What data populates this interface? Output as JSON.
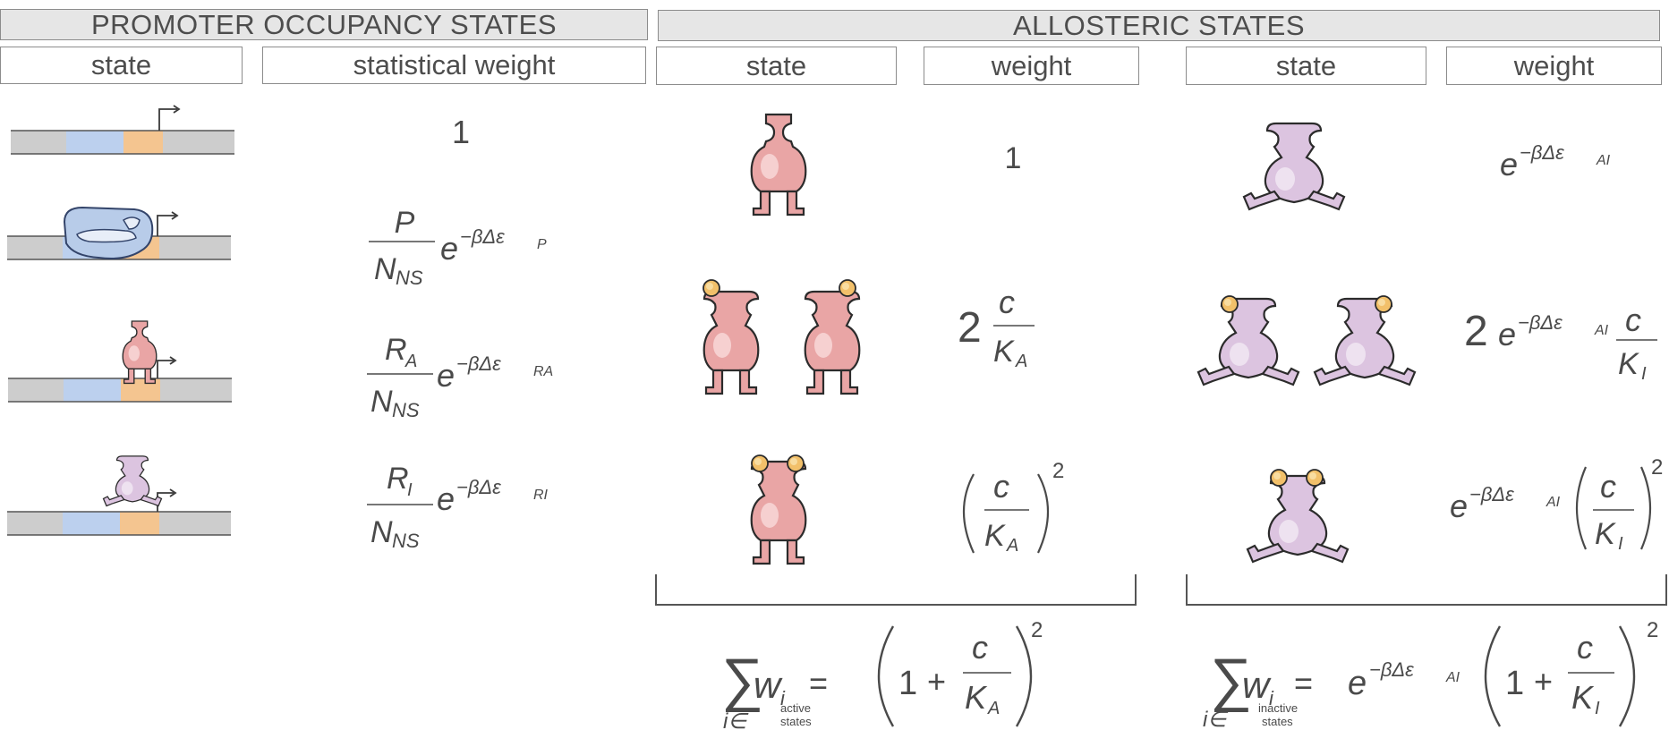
{
  "promoter": {
    "title": "PROMOTER OCCUPANCY STATES",
    "col_state": "state",
    "col_weight": "statistical weight",
    "rows": [
      {
        "state": "empty promoter",
        "weight": "1"
      },
      {
        "state": "RNAP bound",
        "weight": "P / N_NS · e^(−βΔε_P)"
      },
      {
        "state": "active repressor bound",
        "weight": "R_A / N_NS · e^(−βΔε_RA)"
      },
      {
        "state": "inactive repressor bound",
        "weight": "R_I / N_NS · e^(−βΔε_RI)"
      }
    ]
  },
  "allosteric": {
    "title": "ALLOSTERIC STATES",
    "active": {
      "col_state": "state",
      "col_weight": "weight",
      "row1": "1",
      "row2_coef": "2",
      "row3": "(c/K_A)^2",
      "sum": {
        "lhs": "w",
        "under1": "i∈",
        "under_top": "active",
        "under_bottom": "states"
      }
    },
    "inactive": {
      "col_state": "state",
      "col_weight": "weight",
      "row2_coef": "2",
      "sum": {
        "lhs": "w",
        "under1": "i∈",
        "under_top": "inactive",
        "under_bottom": "states"
      }
    }
  },
  "symbols": {
    "c": "c",
    "K": "K",
    "A": "A",
    "I": "I",
    "N": "N",
    "NS": "NS",
    "P": "P",
    "R": "R",
    "one": "1",
    "two": "2",
    "plus": "+",
    "eq": "=",
    "sq": "2",
    "e": "e",
    "exp_P": "−βΔε",
    "sub_P": "P",
    "sub_RA": "RA",
    "sub_RI": "RI",
    "sub_AI": "AI"
  },
  "colors": {
    "active_repressor": "#e9a5a5",
    "inactive_repressor": "#dcc4e0",
    "rnap": "#b8cce9",
    "inducer": "#f2c06a",
    "dna": "#cdcdcd",
    "operator": "#bcd0ee",
    "promoter": "#f4c590",
    "header_bg": "#e6e6e6"
  },
  "icons": [
    "bent-arrow-icon",
    "rnap-icon",
    "active-repressor-icon",
    "inactive-repressor-icon",
    "inducer-icon"
  ]
}
